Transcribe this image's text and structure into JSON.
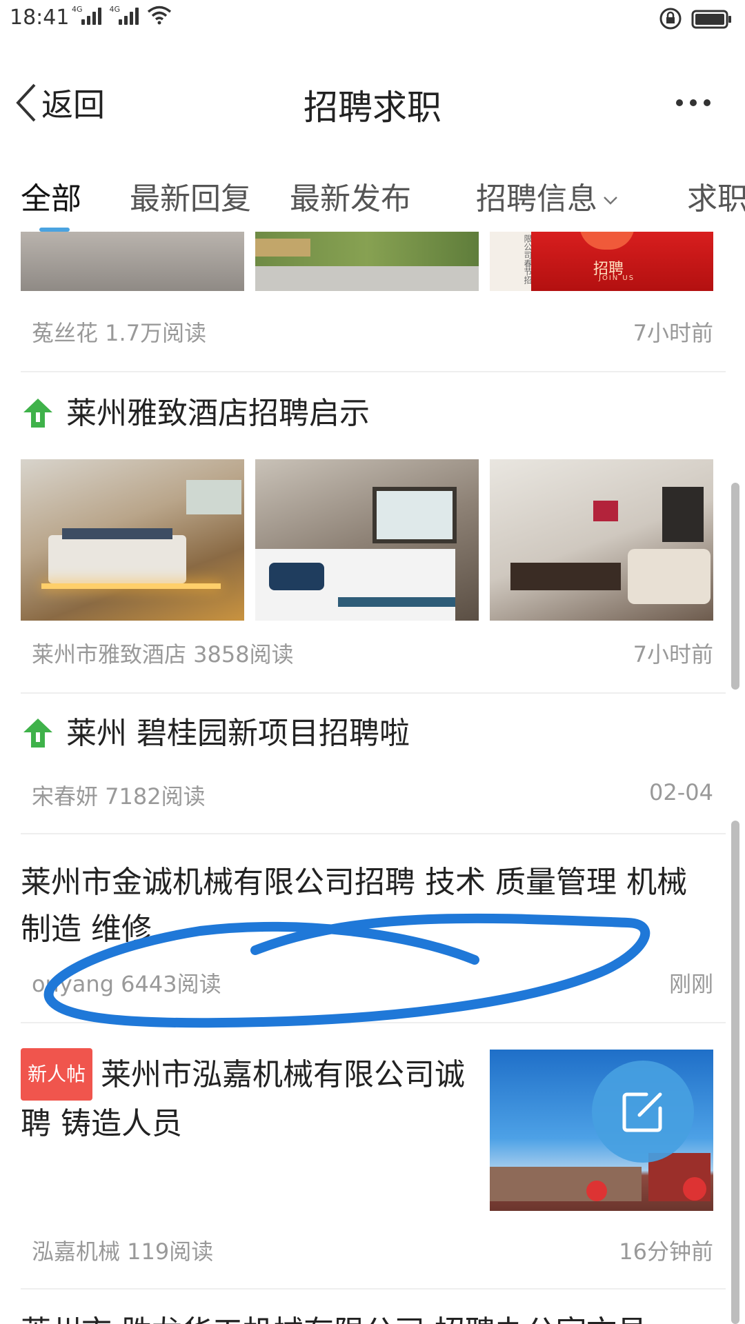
{
  "status_bar": {
    "time": "18:41",
    "net1": "4G",
    "net2": "4G"
  },
  "header": {
    "back_label": "返回",
    "title": "招聘求职"
  },
  "tabs": [
    {
      "label": "全部"
    },
    {
      "label": "最新回复"
    },
    {
      "label": "最新发布"
    },
    {
      "label": "招聘信息"
    },
    {
      "label": "求职"
    }
  ],
  "posts": [
    {
      "images": [
        {
          "caption": ""
        },
        {
          "caption": ""
        },
        {
          "caption": "招聘",
          "caption_en": "JOIN US",
          "side_text": "限公司春节招"
        }
      ],
      "author_reads": "菟丝花 1.7万阅读",
      "time": "7小时前"
    },
    {
      "title": "莱州雅致酒店招聘启示",
      "author_reads": "莱州市雅致酒店 3858阅读",
      "time": "7小时前"
    },
    {
      "title": "莱州 碧桂园新项目招聘啦",
      "author_reads": "宋春妍 7182阅读",
      "time": "02-04"
    },
    {
      "title": "莱州市金诚机械有限公司招聘 技术 质量管理 机械制造 维修",
      "author_reads": "ouyang 6443阅读",
      "time": "刚刚"
    },
    {
      "badge": "新人帖",
      "title": "莱州市泓嘉机械有限公司诚聘 铸造人员",
      "author_reads": "泓嘉机械 119阅读",
      "time": "16分钟前"
    },
    {
      "title_partial": "莱州市 胜龙华工机械有限公司 招聘办公室文员"
    }
  ],
  "colors": {
    "accent": "#4aa3e0",
    "badge": "#f0554d",
    "pin": "#3fb24a",
    "annotation_stroke": "#1f78d8"
  }
}
